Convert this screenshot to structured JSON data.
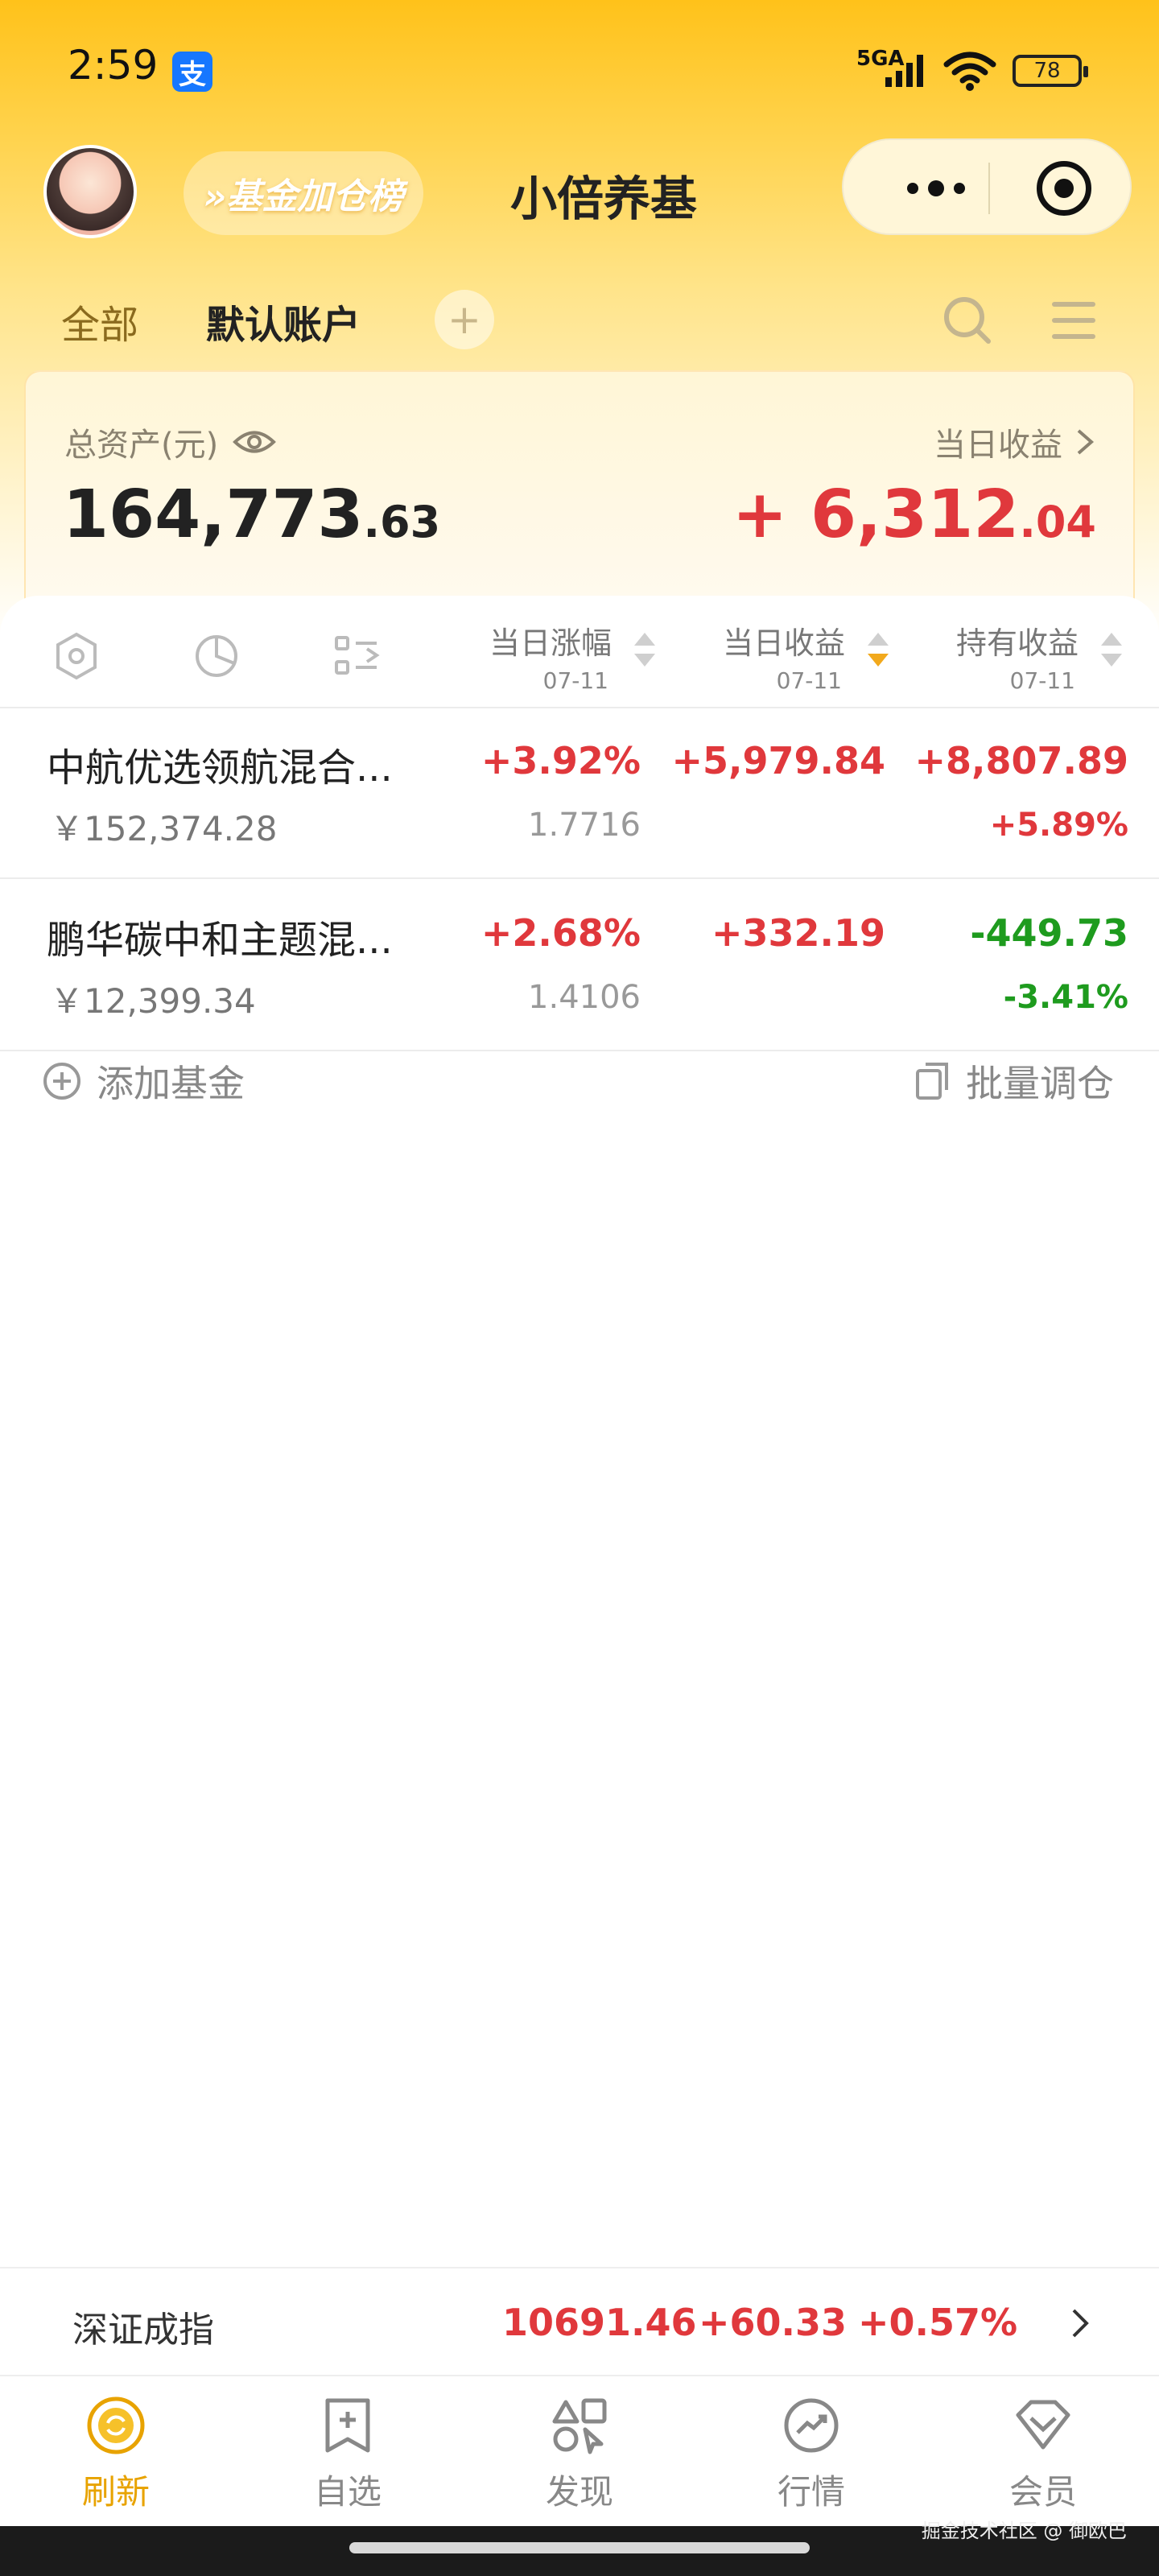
{
  "status_bar": {
    "time": "2:59",
    "alipay_glyph": "支",
    "network": "5GA",
    "battery": "78"
  },
  "header": {
    "promo_label": "»基金加仓榜",
    "title": "小倍养基"
  },
  "tabs": {
    "all": "全部",
    "default_account": "默认账户",
    "add": "+"
  },
  "summary": {
    "total_assets_label": "总资产(元)",
    "total_assets_int": "164,773",
    "total_assets_dec": ".63",
    "daily_income_label": "当日收益",
    "daily_income_int": "+ 6,312",
    "daily_income_dec": ".04"
  },
  "columns": [
    {
      "title": "当日涨幅",
      "date": "07-11"
    },
    {
      "title": "当日收益",
      "date": "07-11"
    },
    {
      "title": "持有收益",
      "date": "07-11"
    }
  ],
  "funds": [
    {
      "name": "中航优选领航混合...",
      "amount": "￥152,374.28",
      "daily_change": "+3.92%",
      "nav": "1.7716",
      "daily_income": "+5,979.84",
      "holding_income": "+8,807.89",
      "holding_rate": "+5.89%"
    },
    {
      "name": "鹏华碳中和主题混...",
      "amount": "￥12,399.34",
      "daily_change": "+2.68%",
      "nav": "1.4106",
      "daily_income": "+332.19",
      "holding_income": "-449.73",
      "holding_rate": "-3.41%"
    }
  ],
  "actions": {
    "add_fund": "添加基金",
    "batch_adjust": "批量调仓"
  },
  "index_bar": {
    "name": "深证成指",
    "value": "10691.46",
    "change": "+60.33",
    "change_pct": "+0.57%"
  },
  "bottom_nav": [
    {
      "label": "刷新",
      "icon": "refresh-icon",
      "active": true
    },
    {
      "label": "自选",
      "icon": "watchlist-icon",
      "active": false
    },
    {
      "label": "发现",
      "icon": "discover-icon",
      "active": false
    },
    {
      "label": "行情",
      "icon": "market-icon",
      "active": false
    },
    {
      "label": "会员",
      "icon": "vip-icon",
      "active": false
    }
  ],
  "watermark": "掘金技术社区 @ 御欧巴",
  "colors": {
    "positive": "#e0383c",
    "negative": "#1e9b1e",
    "accent": "#e8a300",
    "header_bg": "#ffc21a"
  }
}
